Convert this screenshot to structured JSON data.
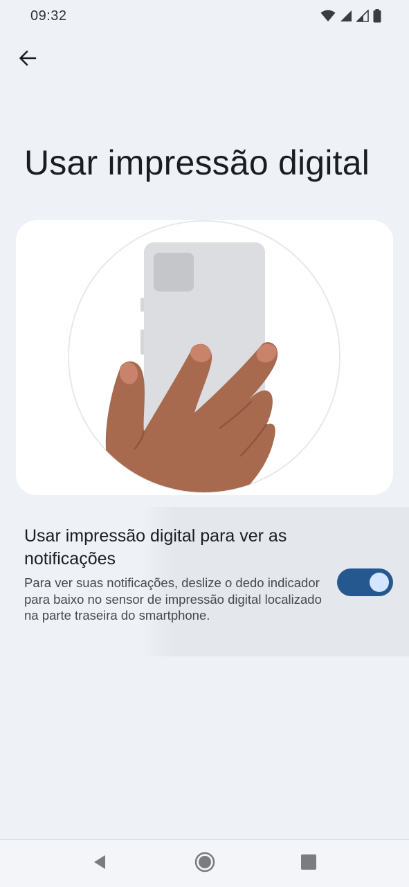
{
  "status_bar": {
    "time": "09:32",
    "icons": [
      "wifi-icon",
      "signal-icon",
      "signal-weak-icon",
      "battery-icon"
    ]
  },
  "toolbar": {
    "back_icon": "arrow-left-icon"
  },
  "page": {
    "title": "Usar impressão digital"
  },
  "illustration": {
    "description_icon": "hand-holding-phone-illustration"
  },
  "setting": {
    "title": "Usar impressão digital para ver as notificações",
    "description": "Para ver suas notificações, deslize o dedo indicador para baixo no sensor de impressão digital localizado na parte traseira do smartphone.",
    "enabled": true
  },
  "nav_bar": {
    "icons": [
      "nav-back-icon",
      "nav-home-icon",
      "nav-recents-icon"
    ]
  },
  "colors": {
    "background": "#eef1f6",
    "toggle_on_track": "#265890",
    "toggle_on_thumb": "#d4e6ff",
    "skin": "#a86a4f",
    "phone": "#dcdde0"
  }
}
